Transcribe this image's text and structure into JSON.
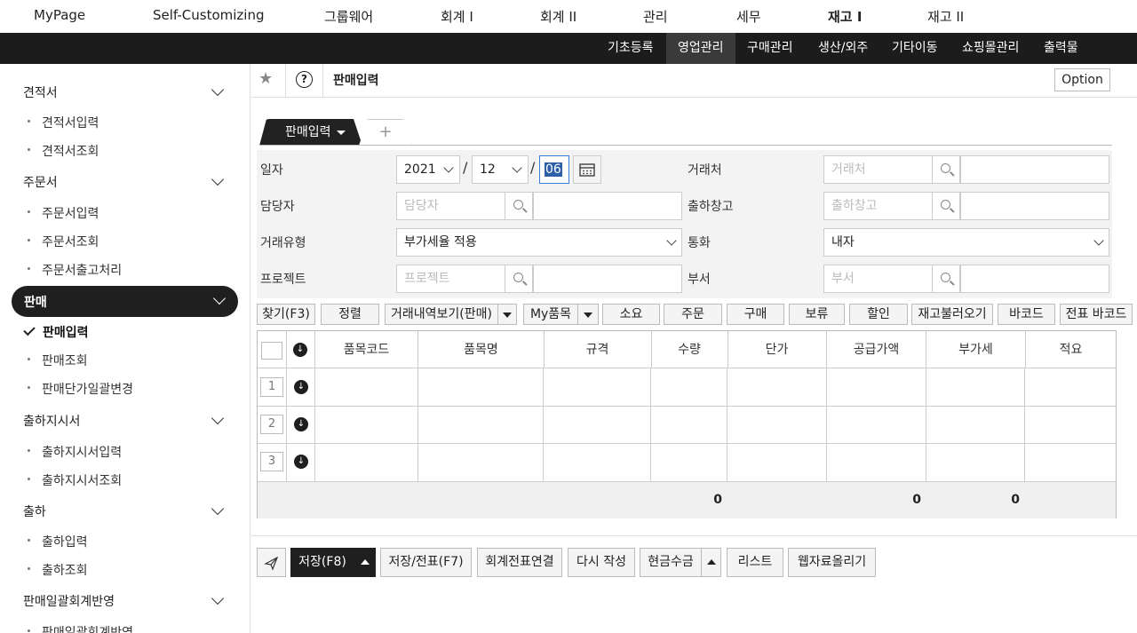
{
  "topnav": {
    "items": [
      "MyPage",
      "Self-Customizing",
      "그룹웨어",
      "회계 I",
      "회계 II",
      "관리",
      "세무",
      "재고 I",
      "재고 II"
    ],
    "active": "재고 I"
  },
  "subnav": {
    "items": [
      "기초등록",
      "영업관리",
      "구매관리",
      "생산/외주",
      "기타이동",
      "쇼핑몰관리",
      "출력물"
    ],
    "active": "영업관리"
  },
  "sidebar": {
    "groups": [
      {
        "label": "견적서",
        "items": [
          "견적서입력",
          "견적서조회"
        ]
      },
      {
        "label": "주문서",
        "items": [
          "주문서입력",
          "주문서조회",
          "주문서출고처리"
        ]
      },
      {
        "label": "판매",
        "items": [
          "판매입력",
          "판매조회",
          "판매단가일괄변경"
        ],
        "active_item": "판매입력"
      },
      {
        "label": "출하지시서",
        "items": [
          "출하지시서입력",
          "출하지시서조회"
        ]
      },
      {
        "label": "출하",
        "items": [
          "출하입력",
          "출하조회"
        ]
      },
      {
        "label": "판매일괄회계반영",
        "items": [
          "판매일괄회계반영"
        ]
      }
    ]
  },
  "titlebar": {
    "title": "판매입력",
    "option_label": "Option",
    "help_glyph": "?"
  },
  "tabs": {
    "active_label": "판매입력",
    "add_glyph": "+"
  },
  "form": {
    "date_label": "일자",
    "year": "2021",
    "month": "12",
    "day": "06",
    "date_sep": "/",
    "client_label": "거래처",
    "client_placeholder": "거래처",
    "manager_label": "담당자",
    "manager_placeholder": "담당자",
    "warehouse_label": "출하창고",
    "warehouse_placeholder": "출하창고",
    "trade_type_label": "거래유형",
    "trade_type_value": "부가세율 적용",
    "currency_label": "통화",
    "currency_value": "내자",
    "project_label": "프로젝트",
    "project_placeholder": "프로젝트",
    "dept_label": "부서",
    "dept_placeholder": "부서"
  },
  "toolbar": {
    "find": "찾기(F3)",
    "sort": "정렬",
    "history": "거래내역보기(판매)",
    "my_items": "My품목",
    "consume": "소요",
    "order": "주문",
    "purchase": "구매",
    "hold": "보류",
    "discount": "할인",
    "stock_load": "재고불러오기",
    "barcode": "바코드",
    "voucher_barcode": "전표 바코드"
  },
  "grid": {
    "columns": [
      "품목코드",
      "품목명",
      "규격",
      "수량",
      "단가",
      "공급가액",
      "부가세",
      "적요"
    ],
    "rows": [
      "1",
      "2",
      "3"
    ],
    "totals": {
      "qty": "0",
      "supply": "0",
      "vat": "0"
    }
  },
  "bottom": {
    "save": "저장(F8)",
    "save_voucher": "저장/전표(F7)",
    "link_voucher": "회계전표연결",
    "rewrite": "다시 작성",
    "cash": "현금수금",
    "list": "리스트",
    "web_upload": "웹자료올리기"
  }
}
